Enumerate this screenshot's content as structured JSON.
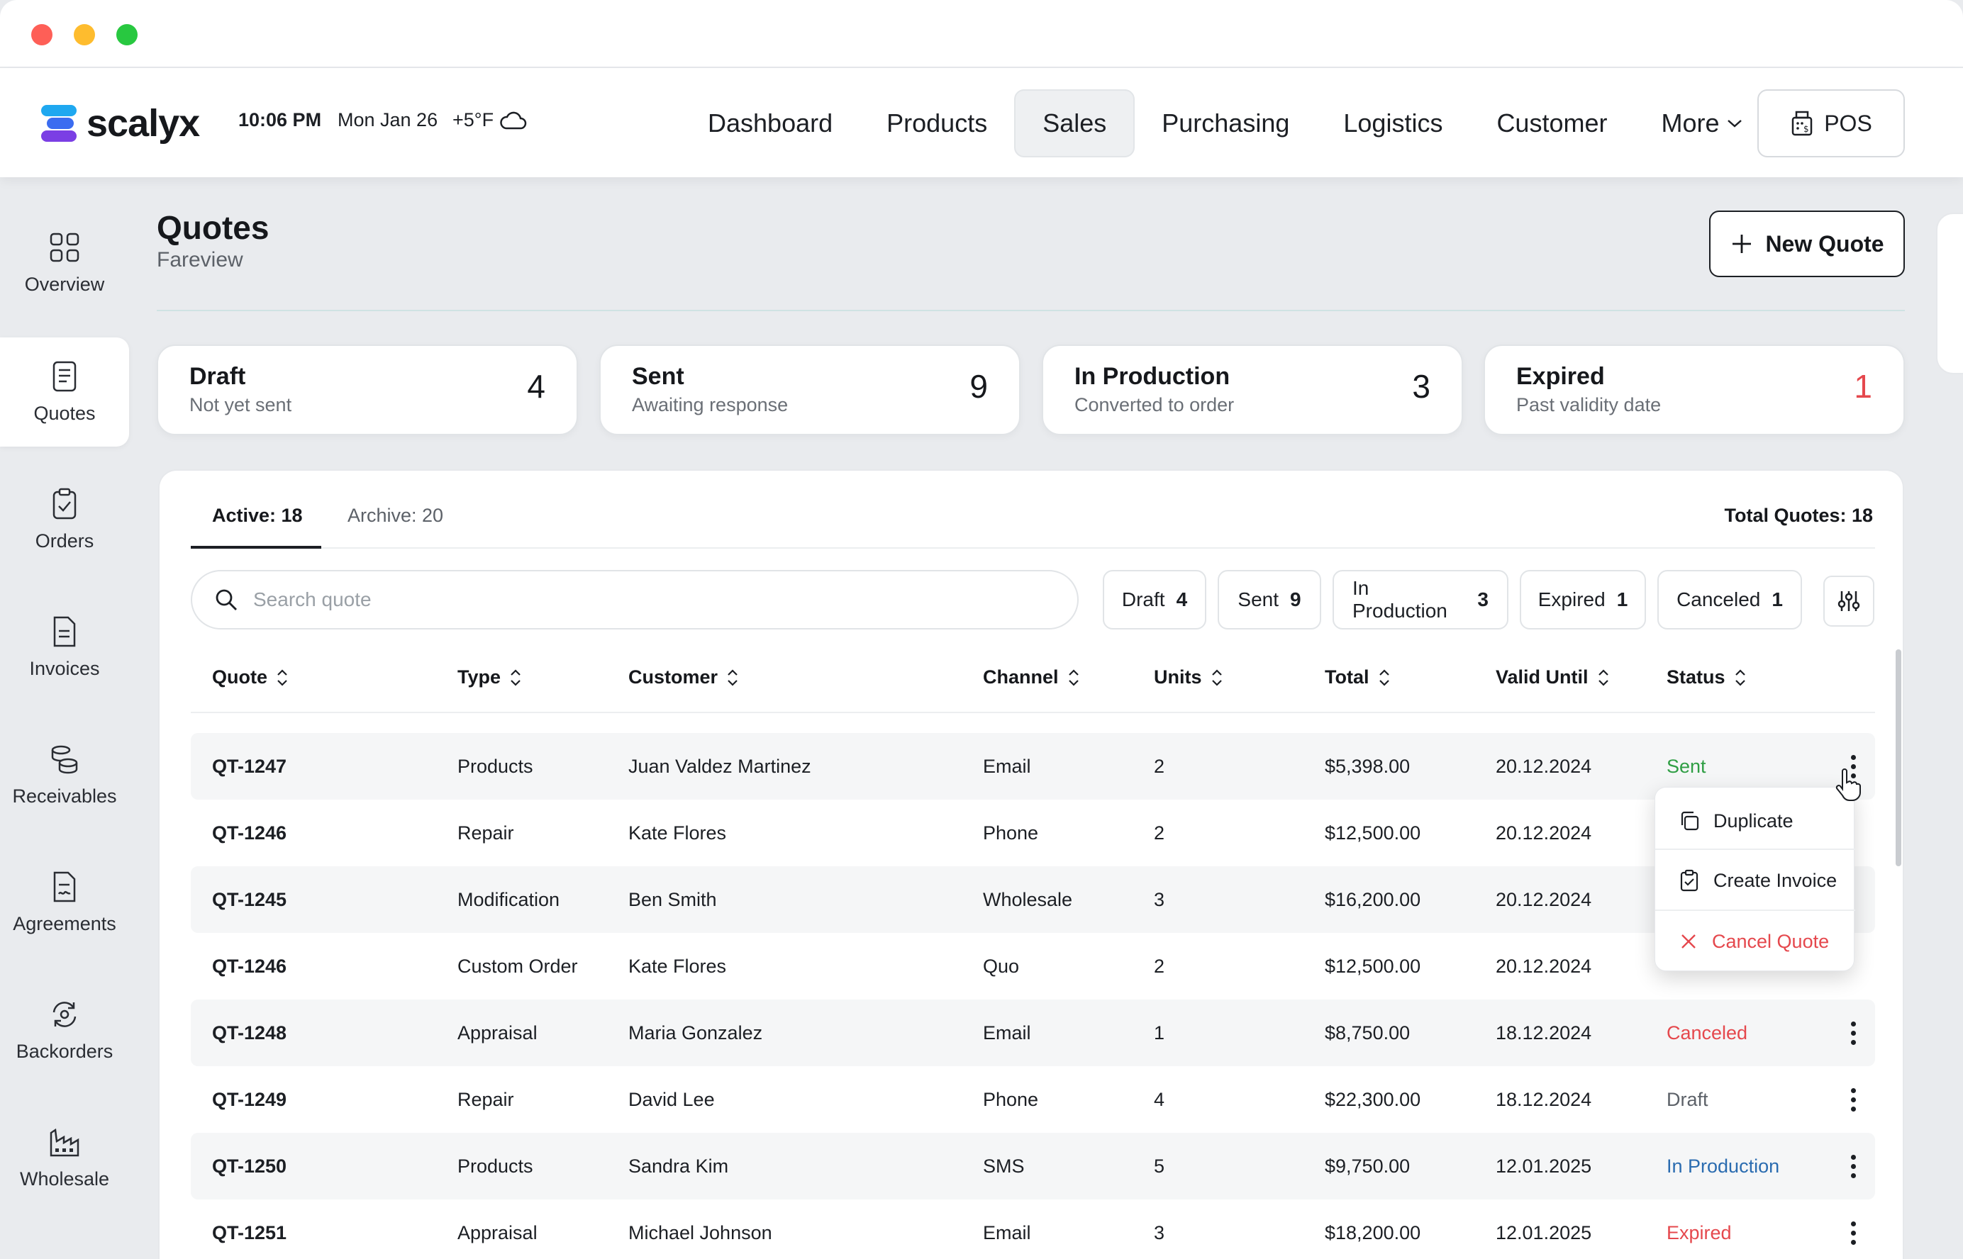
{
  "window": {
    "controls": [
      "close",
      "minimize",
      "maximize"
    ]
  },
  "header": {
    "brand": "scalyx",
    "time": "10:06 PM",
    "date": "Mon Jan 26",
    "temperature": "+5°F",
    "weather_icon": "cloud-icon",
    "nav": [
      {
        "label": "Dashboard"
      },
      {
        "label": "Products"
      },
      {
        "label": "Sales"
      },
      {
        "label": "Purchasing"
      },
      {
        "label": "Logistics"
      },
      {
        "label": "Customer"
      },
      {
        "label": "More"
      }
    ],
    "active_nav": "Sales",
    "pos_label": "POS"
  },
  "sidebar": {
    "items": [
      {
        "label": "Overview",
        "icon": "grid-icon"
      },
      {
        "label": "Quotes",
        "icon": "document-icon"
      },
      {
        "label": "Orders",
        "icon": "clipboard-check-icon"
      },
      {
        "label": "Invoices",
        "icon": "invoice-icon"
      },
      {
        "label": "Receivables",
        "icon": "coins-icon"
      },
      {
        "label": "Agreements",
        "icon": "agreement-icon"
      },
      {
        "label": "Backorders",
        "icon": "refresh-icon"
      },
      {
        "label": "Wholesale",
        "icon": "factory-icon"
      }
    ],
    "active": "Quotes"
  },
  "page": {
    "title": "Quotes",
    "subtitle": "Fareview",
    "new_quote_label": "New Quote"
  },
  "stats": [
    {
      "title": "Draft",
      "subtitle": "Not yet sent",
      "count": "4"
    },
    {
      "title": "Sent",
      "subtitle": "Awaiting response",
      "count": "9"
    },
    {
      "title": "In Production",
      "subtitle": "Converted to order",
      "count": "3"
    },
    {
      "title": "Expired",
      "subtitle": "Past validity date",
      "count": "1"
    }
  ],
  "tabs": [
    {
      "label": "Active: 18"
    },
    {
      "label": "Archive: 20"
    }
  ],
  "total_quotes": "Total Quotes: 18",
  "search": {
    "placeholder": "Search quote",
    "value": ""
  },
  "filters": [
    {
      "label": "Draft",
      "count": "4"
    },
    {
      "label": "Sent",
      "count": "9"
    },
    {
      "label": "In Production",
      "count": "3"
    },
    {
      "label": "Expired",
      "count": "1"
    },
    {
      "label": "Canceled",
      "count": "1"
    }
  ],
  "table": {
    "columns": [
      "Quote",
      "Type",
      "Customer",
      "Channel",
      "Units",
      "Total",
      "Valid Until",
      "Status"
    ],
    "rows": [
      {
        "quote": "QT-1247",
        "type": "Products",
        "customer": "Juan Valdez Martinez",
        "channel": "Email",
        "units": "2",
        "total": "$5,398.00",
        "valid": "20.12.2024",
        "status": "Sent"
      },
      {
        "quote": "QT-1246",
        "type": "Repair",
        "customer": "Kate Flores",
        "channel": "Phone",
        "units": "2",
        "total": "$12,500.00",
        "valid": "20.12.2024",
        "status": ""
      },
      {
        "quote": "QT-1245",
        "type": "Modification",
        "customer": "Ben Smith",
        "channel": "Wholesale",
        "units": "3",
        "total": "$16,200.00",
        "valid": "20.12.2024",
        "status": ""
      },
      {
        "quote": "QT-1246",
        "type": "Custom Order",
        "customer": "Kate Flores",
        "channel": "Quo",
        "units": "2",
        "total": "$12,500.00",
        "valid": "20.12.2024",
        "status": ""
      },
      {
        "quote": "QT-1248",
        "type": "Appraisal",
        "customer": "Maria Gonzalez",
        "channel": "Email",
        "units": "1",
        "total": "$8,750.00",
        "valid": "18.12.2024",
        "status": "Canceled"
      },
      {
        "quote": "QT-1249",
        "type": "Repair",
        "customer": "David Lee",
        "channel": "Phone",
        "units": "4",
        "total": "$22,300.00",
        "valid": "18.12.2024",
        "status": "Draft"
      },
      {
        "quote": "QT-1250",
        "type": "Products",
        "customer": "Sandra Kim",
        "channel": "SMS",
        "units": "5",
        "total": "$9,750.00",
        "valid": "12.01.2025",
        "status": "In Production"
      },
      {
        "quote": "QT-1251",
        "type": "Appraisal",
        "customer": "Michael Johnson",
        "channel": "Email",
        "units": "3",
        "total": "$18,200.00",
        "valid": "12.01.2025",
        "status": "Expired"
      }
    ]
  },
  "status_colors": {
    "Sent": "#2f9e44",
    "Canceled": "#e5484d",
    "Draft": "#5c6168",
    "In Production": "#2b6cb0",
    "Expired": "#e5484d"
  },
  "row_menu": [
    {
      "label": "Duplicate",
      "icon": "duplicate-icon"
    },
    {
      "label": "Create Invoice",
      "icon": "clipboard-check-icon"
    },
    {
      "label": "Cancel Quote",
      "icon": "close-icon"
    }
  ]
}
